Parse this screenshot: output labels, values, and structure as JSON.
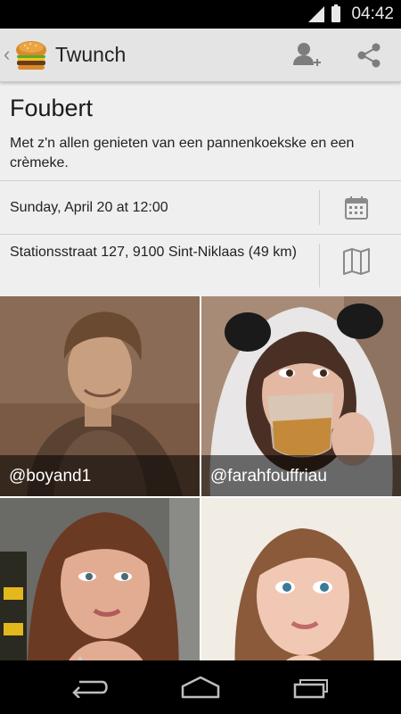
{
  "status_bar": {
    "time": "04:42"
  },
  "action_bar": {
    "title": "Twunch",
    "icons": {
      "app": "burger-icon",
      "add_person": "add-person-icon",
      "share": "share-icon"
    }
  },
  "event": {
    "title": "Foubert",
    "description": "Met z'n allen genieten van een pannenkoekske en een crèmeke.",
    "date": "Sunday, April 20 at 12:00",
    "location": "Stationsstraat 127, 9100 Sint-Niklaas (49 km)",
    "icons": {
      "date": "calendar-icon",
      "location": "map-icon"
    }
  },
  "attendees": [
    {
      "handle": "@boyand1"
    },
    {
      "handle": "@farahfouffriau"
    },
    {
      "handle": ""
    },
    {
      "handle": ""
    }
  ],
  "nav_bar": {
    "icons": [
      "back-icon",
      "home-icon",
      "recent-apps-icon"
    ]
  },
  "colors": {
    "action_bar": "#e4e4e4",
    "card": "#efefef",
    "status_bar": "#000000",
    "icon_gray": "#8a8a8a"
  }
}
